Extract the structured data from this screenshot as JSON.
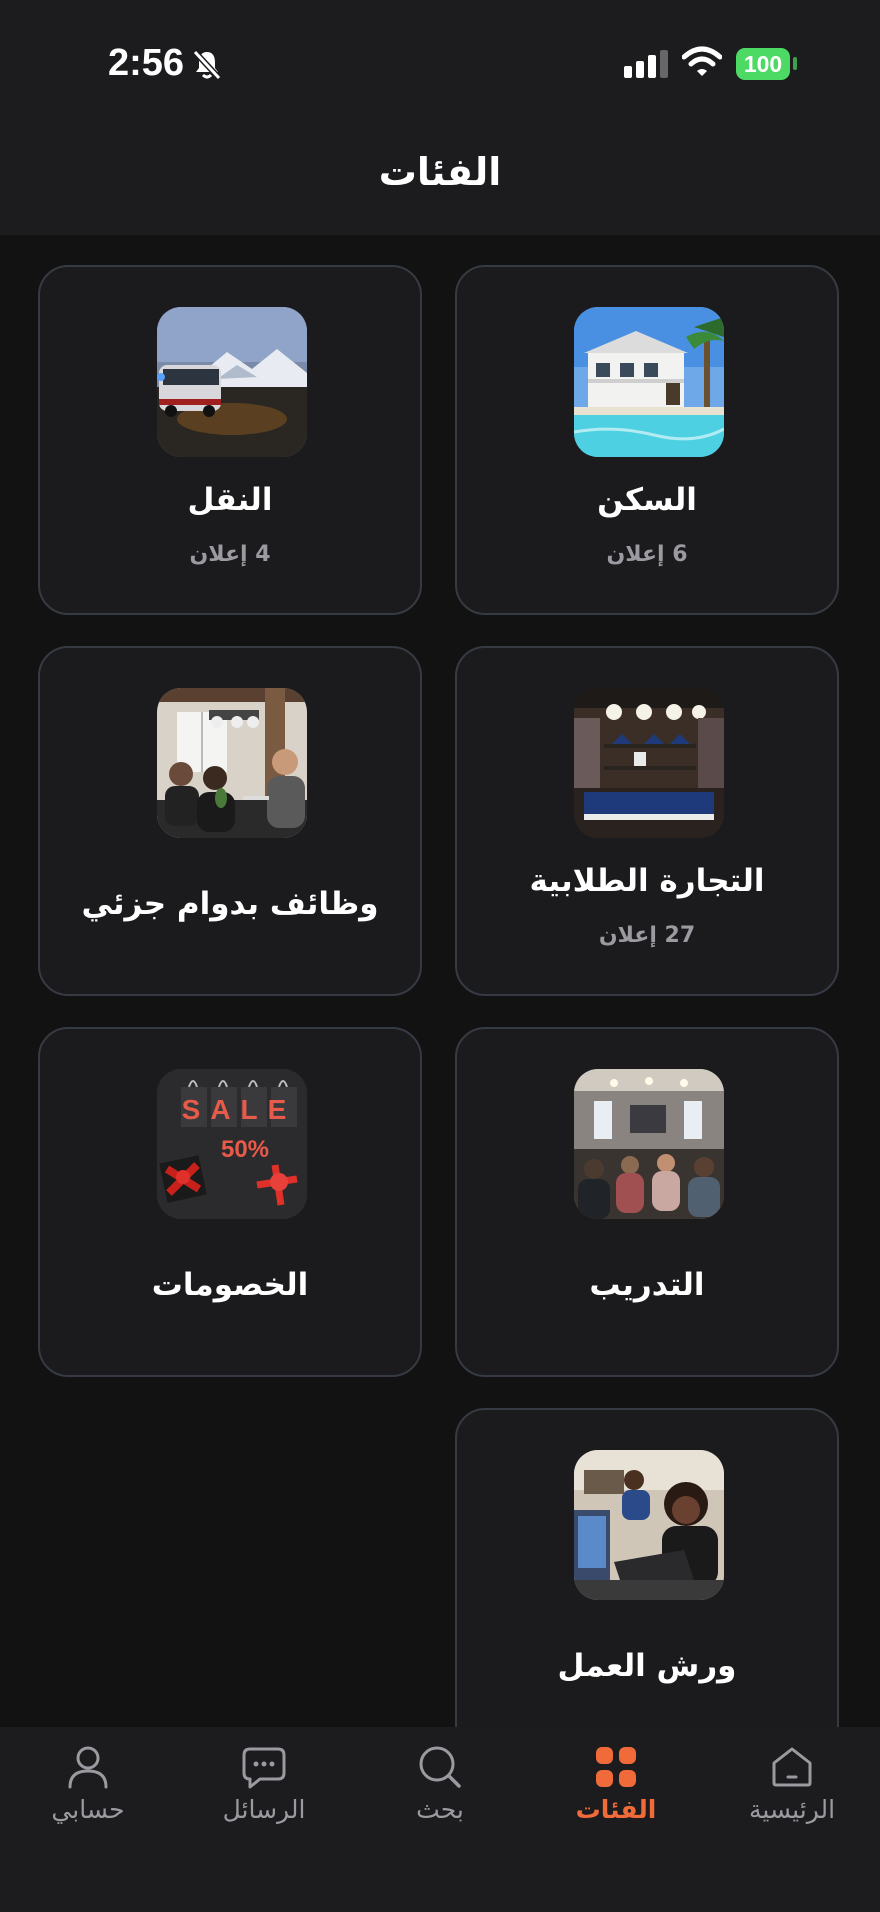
{
  "status_bar": {
    "time": "2:56",
    "battery": "100"
  },
  "header": {
    "title": "الفئات"
  },
  "categories": [
    {
      "title": "السكن",
      "count": "6 إعلان"
    },
    {
      "title": "النقل",
      "count": "4 إعلان"
    },
    {
      "title": "التجارة الطلابية",
      "count": "27 إعلان"
    },
    {
      "title": "وظائف بدوام جزئي"
    },
    {
      "title": "التدريب"
    },
    {
      "title": "الخصومات",
      "image_text": "SALE",
      "image_percent": "50%"
    },
    {
      "title": "ورش العمل"
    }
  ],
  "tabs": [
    {
      "label": "الرئيسية",
      "icon": "home-icon"
    },
    {
      "label": "الفئات",
      "icon": "grid-icon",
      "active": true
    },
    {
      "label": "بحث",
      "icon": "search-icon"
    },
    {
      "label": "الرسائل",
      "icon": "chat-icon"
    },
    {
      "label": "حسابي",
      "icon": "user-icon"
    }
  ],
  "colors": {
    "accent": "#f06a3a",
    "background": "#121212",
    "card": "#1b1b1d",
    "card_border": "#363a42",
    "battery": "#4cd964"
  }
}
